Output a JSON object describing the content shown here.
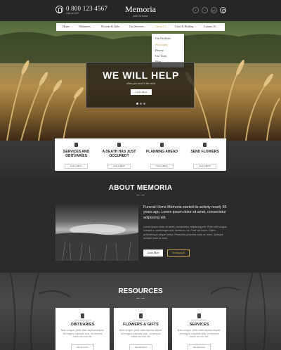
{
  "header": {
    "phone": "0 800 123 4567",
    "phone_sub": "Call us 24/7",
    "logo": "Memoria",
    "logo_sub": "funeral home",
    "social": [
      "f",
      "t",
      "g+"
    ]
  },
  "nav": {
    "items": [
      "Home",
      "Obituaries",
      "Flowers & Gifts",
      "Our Services",
      "About Us",
      "Grief & Healing",
      "Contact Us"
    ],
    "active": "About Us"
  },
  "dropdown": {
    "items": [
      "Our Facilities",
      "Philosophy",
      "History",
      "Our Team",
      "Blog"
    ],
    "active": "Philosophy"
  },
  "hero": {
    "title": "WE WILL HELP",
    "subtitle": "when you need it the most",
    "button": "Learn More"
  },
  "services": [
    {
      "title": "SERVICES AND OBITUARIES",
      "button": "Learn More"
    },
    {
      "title": "A DEATH HAS JUST OCCURED?",
      "button": "Learn More"
    },
    {
      "title": "PLANNING AHEAD",
      "button": "Learn More"
    },
    {
      "title": "SEND FLOWERS",
      "button": "Learn More"
    }
  ],
  "about": {
    "title": "ABOUT MEMORIA",
    "lead": "Funeral Home Memoria started its activity nearly 85 years ago. Lorem ipsum dolor sit amet, consectetur adipiscing elit.",
    "body": "Lorem ipsum dolor sit amet, consectetur adipiscing elit. Proin nibh augue, suscipit a, scelerisque sed, lacinia in, mi. Cras vel lorem. Etiam pellentesque aliquet tellus. Phasellus pharetra nulla ac diam. Quisque semper justo at risus.",
    "btn_more": "Learn More",
    "btn_testimonials": "Testimonials"
  },
  "resources": {
    "title": "RESOURCES",
    "cards": [
      {
        "name": "OBITUARIES",
        "text": "Nam congue, pede vitae dapibus aliquet, elit magna vulputate arcu, vel tempus metus leo non est.",
        "button": "See Services"
      },
      {
        "name": "FLOWERS & GIFTS",
        "text": "Nam congue, pede vitae dapibus aliquet, elit magna vulputate arcu, vel tempus metus leo non est.",
        "button": "See Services"
      },
      {
        "name": "SERVICES",
        "text": "Nam congue, pede vitae dapibus aliquet, elit magna vulputate arcu, vel tempus metus leo non est.",
        "button": "See Services"
      }
    ]
  },
  "colors": {
    "accent": "#c9a55a",
    "dark": "#2b2b2b"
  }
}
